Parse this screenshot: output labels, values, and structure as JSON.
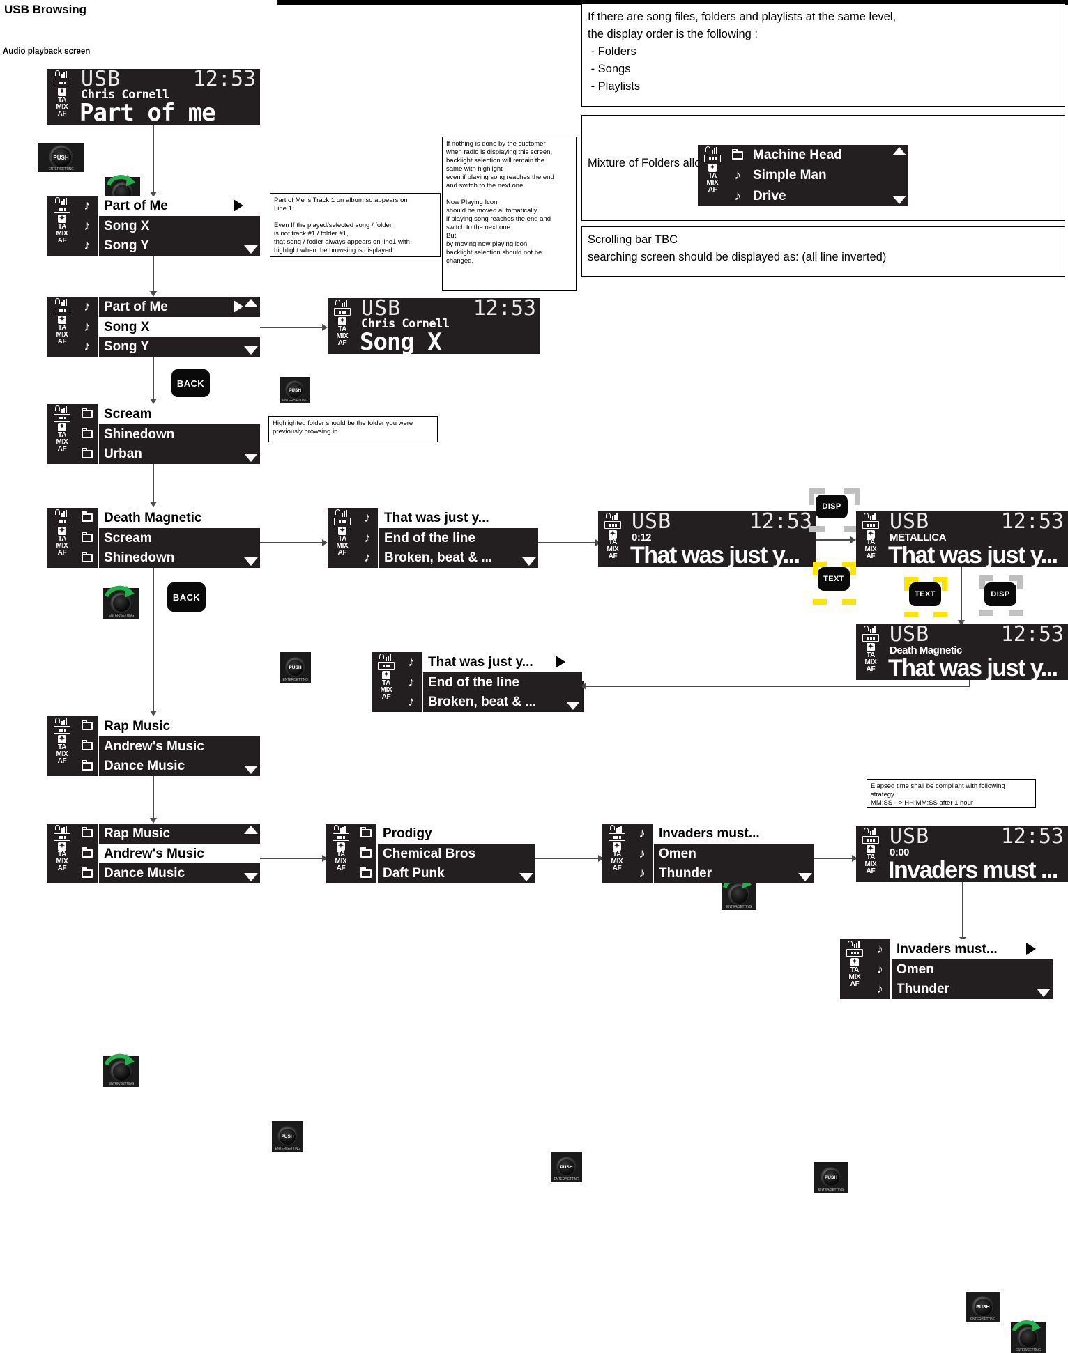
{
  "page": {
    "title": "USB Browsing",
    "subtitle": "Audio playback screen"
  },
  "status_icons": {
    "signal": "signal-bars-icon",
    "battery": "battery-icon",
    "bluetooth": "bluetooth-icon",
    "ta": "TA",
    "mix": "MIX",
    "af": "AF"
  },
  "notes": {
    "order_rule": "If there are song files, folders and playlists at the same level,\nthe display order is the following :\n - Folders\n - Songs\n - Playlists",
    "mixture": "Mixture of Folders allongside tracks is required",
    "scrolling": "Scrolling bar TBC\nsearching screen should be displayed as: (all line inverted)",
    "track1": "Part of Me is Track 1 on album so appears on\nLine 1.\n\nEven If the played/selected song / folder\nis not track #1 / folder #1,\nthat song / fodler always appears on line1 with\nhighlight when the browsing is displayed.",
    "backlight": "If nothing is done by the customer\nwhen radio is displaying this screen,\nbacklight selection will remain the\nsame with highlight\neven if playing song reaches the end\nand switch to the next one.\n\nNow Playing Icon\nshould be moved automatically\nif playing song reaches the end and\nswitch to the next one.\nBut\nby moving now playing icon,\nbacklight selection should not be\nchanged.",
    "highlighted_folder": "Highlighted folder should be the folder you were\npreviously browsing in",
    "elapsed_time": "Elapsed time shall be compliant with following\nstrategy :\nMM:SS --> HH:MM:SS after 1 hour"
  },
  "buttons": {
    "push": "PUSH",
    "knob_caption": "ENTER/SETTING",
    "back": "BACK",
    "disp": "DISP",
    "text": "TEXT"
  },
  "screens": {
    "np_part_of_me": {
      "source": "USB",
      "clock": "12:53",
      "artist": "Chris Cornell",
      "title": "Part of me"
    },
    "np_song_x": {
      "source": "USB",
      "clock": "12:53",
      "artist": "Chris Cornell",
      "title": "Song X"
    },
    "np_elapsed_012": {
      "source": "USB",
      "clock": "12:53",
      "artist": "0:12",
      "title": "That was just y..."
    },
    "np_metallica": {
      "source": "USB",
      "clock": "12:53",
      "artist": "METALLICA",
      "title": "That was just y..."
    },
    "np_death_mag": {
      "source": "USB",
      "clock": "12:53",
      "artist": "Death Magnetic",
      "title": "That was just y..."
    },
    "np_invaders": {
      "source": "USB",
      "clock": "12:53",
      "artist": "0:00",
      "title": "Invaders must ..."
    }
  },
  "lists": {
    "songs_sel_part_of_me": {
      "rows": [
        {
          "icon": "note-icon",
          "label": "Part of Me",
          "selected": true,
          "now_playing": true
        },
        {
          "icon": "note-icon",
          "label": "Song X",
          "selected": false,
          "now_playing": false
        },
        {
          "icon": "note-icon",
          "label": "Song Y",
          "selected": false,
          "now_playing": false
        }
      ]
    },
    "songs_sel_song_x": {
      "rows": [
        {
          "icon": "note-icon",
          "label": "Part of Me",
          "selected": false,
          "now_playing": true
        },
        {
          "icon": "note-icon",
          "label": "Song X",
          "selected": true,
          "now_playing": false
        },
        {
          "icon": "note-icon",
          "label": "Song Y",
          "selected": false,
          "now_playing": false
        }
      ]
    },
    "folders_scream": {
      "rows": [
        {
          "icon": "folder-icon",
          "label": "Scream",
          "selected": true,
          "now_playing": false
        },
        {
          "icon": "folder-icon",
          "label": "Shinedown",
          "selected": false,
          "now_playing": false
        },
        {
          "icon": "folder-icon",
          "label": "Urban",
          "selected": false,
          "now_playing": false
        }
      ]
    },
    "folders_death_magnetic": {
      "rows": [
        {
          "icon": "folder-icon",
          "label": "Death Magnetic",
          "selected": true,
          "now_playing": false
        },
        {
          "icon": "folder-icon",
          "label": "Scream",
          "selected": false,
          "now_playing": false
        },
        {
          "icon": "folder-icon",
          "label": "Shinedown",
          "selected": false,
          "now_playing": false
        }
      ]
    },
    "tracks_metallica": {
      "rows": [
        {
          "icon": "note-icon",
          "label": "That was just y...",
          "selected": true,
          "now_playing": false
        },
        {
          "icon": "note-icon",
          "label": "End of the line",
          "selected": false,
          "now_playing": false
        },
        {
          "icon": "note-icon",
          "label": "Broken, beat & ...",
          "selected": false,
          "now_playing": false
        }
      ]
    },
    "tracks_metallica_playing": {
      "rows": [
        {
          "icon": "note-icon",
          "label": "That was just y...",
          "selected": true,
          "now_playing": true
        },
        {
          "icon": "note-icon",
          "label": "End of the line",
          "selected": false,
          "now_playing": false
        },
        {
          "icon": "note-icon",
          "label": "Broken, beat & ...",
          "selected": false,
          "now_playing": false
        }
      ]
    },
    "folders_rap_sel_rap": {
      "rows": [
        {
          "icon": "folder-icon",
          "label": "Rap Music",
          "selected": true,
          "now_playing": false
        },
        {
          "icon": "folder-icon",
          "label": "Andrew's Music",
          "selected": false,
          "now_playing": false
        },
        {
          "icon": "folder-icon",
          "label": "Dance Music",
          "selected": false,
          "now_playing": false
        }
      ]
    },
    "folders_rap_sel_andrew": {
      "rows": [
        {
          "icon": "folder-icon",
          "label": "Rap Music",
          "selected": false,
          "now_playing": false
        },
        {
          "icon": "folder-icon",
          "label": "Andrew's Music",
          "selected": true,
          "now_playing": false
        },
        {
          "icon": "folder-icon",
          "label": "Dance Music",
          "selected": false,
          "now_playing": false
        }
      ]
    },
    "folders_prodigy": {
      "rows": [
        {
          "icon": "folder-icon",
          "label": "Prodigy",
          "selected": true,
          "now_playing": false
        },
        {
          "icon": "folder-icon",
          "label": "Chemical Bros",
          "selected": false,
          "now_playing": false
        },
        {
          "icon": "folder-icon",
          "label": "Daft Punk",
          "selected": false,
          "now_playing": false
        }
      ]
    },
    "tracks_invaders": {
      "rows": [
        {
          "icon": "note-icon",
          "label": "Invaders must...",
          "selected": true,
          "now_playing": false
        },
        {
          "icon": "note-icon",
          "label": "Omen",
          "selected": false,
          "now_playing": false
        },
        {
          "icon": "note-icon",
          "label": "Thunder",
          "selected": false,
          "now_playing": false
        }
      ]
    },
    "tracks_invaders_playing": {
      "rows": [
        {
          "icon": "note-icon",
          "label": "Invaders must...",
          "selected": true,
          "now_playing": true
        },
        {
          "icon": "note-icon",
          "label": "Omen",
          "selected": false,
          "now_playing": false
        },
        {
          "icon": "note-icon",
          "label": "Thunder",
          "selected": false,
          "now_playing": false
        }
      ]
    },
    "mixed_machine_head": {
      "rows": [
        {
          "icon": "folder-icon",
          "label": "Machine Head",
          "selected": false,
          "now_playing": false
        },
        {
          "icon": "note-icon",
          "label": "Simple Man",
          "selected": false,
          "now_playing": false
        },
        {
          "icon": "note-icon",
          "label": "Drive",
          "selected": false,
          "now_playing": false
        }
      ]
    }
  }
}
